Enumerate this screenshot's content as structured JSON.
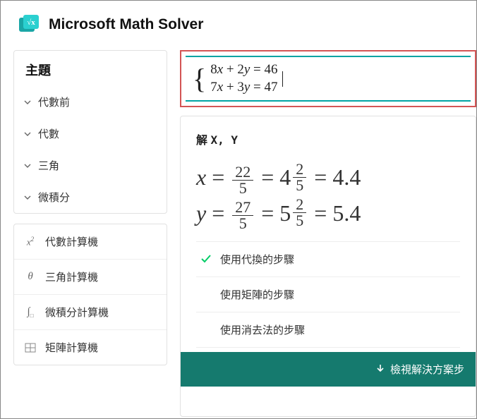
{
  "header": {
    "title": "Microsoft Math Solver"
  },
  "sidebar": {
    "topics_title": "主題",
    "topics": [
      {
        "label": "代數前"
      },
      {
        "label": "代數"
      },
      {
        "label": "三角"
      },
      {
        "label": "微積分"
      }
    ],
    "calculators": [
      {
        "label": "代數計算機",
        "icon": "algebra"
      },
      {
        "label": "三角計算機",
        "icon": "theta"
      },
      {
        "label": "微積分計算機",
        "icon": "integral"
      },
      {
        "label": "矩陣計算機",
        "icon": "matrix"
      }
    ]
  },
  "equation": {
    "line1": "8x + 2y = 46",
    "line2": "7x + 3y = 47"
  },
  "solution": {
    "heading_prefix": "解 ",
    "heading_vars": "X, Y",
    "x": {
      "frac_num": "22",
      "frac_den": "5",
      "mixed_whole": "4",
      "mixed_num": "2",
      "mixed_den": "5",
      "decimal": "4.4"
    },
    "y": {
      "frac_num": "27",
      "frac_den": "5",
      "mixed_whole": "5",
      "mixed_num": "2",
      "mixed_den": "5",
      "decimal": "5.4"
    }
  },
  "steps": [
    {
      "label": "使用代換的步驟",
      "selected": true
    },
    {
      "label": "使用矩陣的步驟",
      "selected": false
    },
    {
      "label": "使用消去法的步驟",
      "selected": false
    }
  ],
  "footer": {
    "label": "檢視解決方案步"
  }
}
